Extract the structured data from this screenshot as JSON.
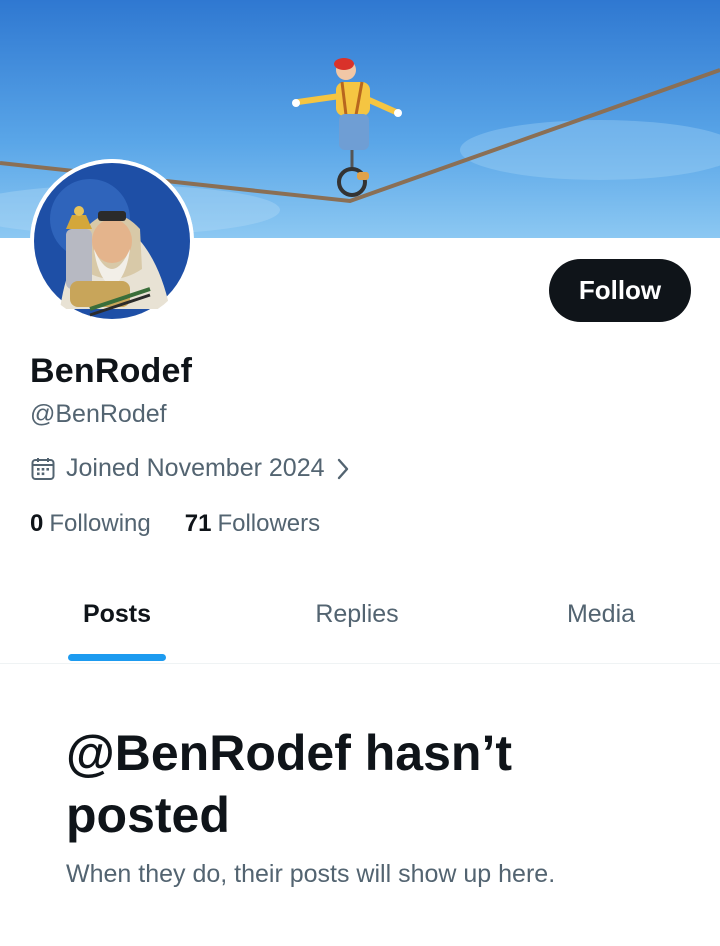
{
  "profile": {
    "display_name": "BenRodef",
    "handle": "@BenRodef",
    "joined": "Joined November 2024",
    "follow_label": "Follow"
  },
  "stats": {
    "following_count": "0",
    "following_label": "Following",
    "followers_count": "71",
    "followers_label": "Followers"
  },
  "tabs": [
    {
      "label": "Posts",
      "active": true
    },
    {
      "label": "Replies",
      "active": false
    },
    {
      "label": "Media",
      "active": false
    }
  ],
  "empty_state": {
    "title": "@BenRodef hasn’t posted",
    "subtitle": "When they do, their posts will show up here."
  },
  "icons": {
    "calendar": "calendar-icon",
    "chevron": "chevron-right-icon"
  },
  "colors": {
    "text_primary": "#0f1419",
    "text_secondary": "#536471",
    "accent": "#1d9bf0",
    "follow_button_bg": "#0f1419"
  }
}
